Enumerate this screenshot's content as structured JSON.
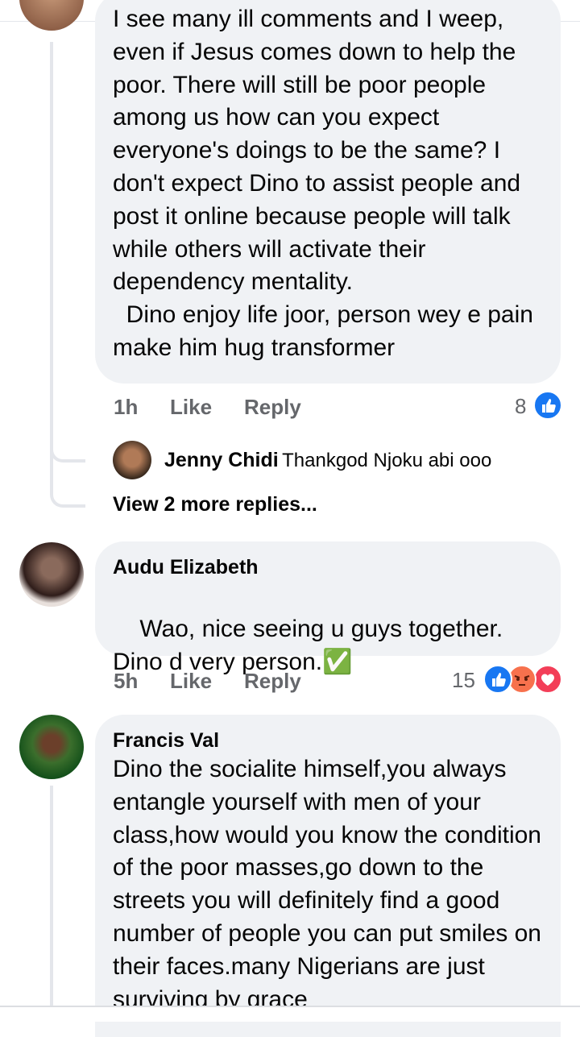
{
  "comments": [
    {
      "text": "I see many ill comments and I weep, even if Jesus comes down to help the poor. There will still be poor people among us how can you expect everyone's doings to be the same? I don't expect Dino to assist people and post it online because people will talk while others will activate their dependency mentality.\n  Dino enjoy life joor, person wey e pain make him hug transformer",
      "time": "1h",
      "like": "Like",
      "reply": "Reply",
      "reaction_count": "8",
      "reactions": [
        "like"
      ]
    },
    {
      "author": "Audu Elizabeth",
      "text": "Wao, nice seeing u guys together. Dino d very person.",
      "emoji": "✅",
      "time": "5h",
      "like": "Like",
      "reply": "Reply",
      "reaction_count": "15",
      "reactions": [
        "like",
        "angry",
        "love"
      ]
    },
    {
      "author": "Francis Val",
      "text": "Dino the socialite himself,you always entangle yourself with men of your class,how would you know the condition of the poor masses,go down to the streets you will definitely find a good number of people you can put smiles on their faces.many Nigerians are just surviving by grace"
    }
  ],
  "reply_preview": {
    "name": "Jenny Chidi",
    "text": "Thankgod Njoku abi ooo"
  },
  "view_more": "View 2 more replies...",
  "colors": {
    "bubble": "#f0f2f5",
    "meta": "#65676b",
    "like_blue": "#1877f2",
    "angry": "#f7714d",
    "love": "#f33e58"
  }
}
